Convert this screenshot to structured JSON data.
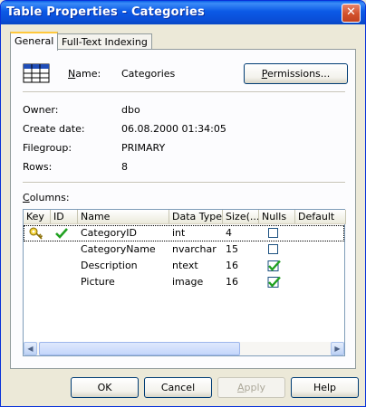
{
  "window": {
    "title": "Table Properties - Categories",
    "close_glyph": "✕"
  },
  "tabs": [
    {
      "label": "General",
      "active": true
    },
    {
      "label": "Full-Text Indexing",
      "active": false
    }
  ],
  "general": {
    "table_icon": "table-grid-icon",
    "name_label": "Name:",
    "name_value": "Categories",
    "permissions_button": "Permissions...",
    "owner_label": "Owner:",
    "owner_value": "dbo",
    "create_date_label": "Create date:",
    "create_date_value": "06.08.2000 01:34:05",
    "filegroup_label": "Filegroup:",
    "filegroup_value": "PRIMARY",
    "rows_label": "Rows:",
    "rows_value": "8",
    "columns_label": "Columns:"
  },
  "columns_grid": {
    "headers": [
      "Key",
      "ID",
      "Name",
      "Data Type",
      "Size(...",
      "Nulls",
      "Default"
    ],
    "rows": [
      {
        "key": true,
        "id": true,
        "name": "CategoryID",
        "type": "int",
        "size": "4",
        "nulls": false,
        "selected": true
      },
      {
        "key": false,
        "id": false,
        "name": "CategoryName",
        "type": "nvarchar",
        "size": "15",
        "nulls": false,
        "selected": false
      },
      {
        "key": false,
        "id": false,
        "name": "Description",
        "type": "ntext",
        "size": "16",
        "nulls": true,
        "selected": false
      },
      {
        "key": false,
        "id": false,
        "name": "Picture",
        "type": "image",
        "size": "16",
        "nulls": true,
        "selected": false
      }
    ]
  },
  "footer": {
    "ok": "OK",
    "cancel": "Cancel",
    "apply": "Apply",
    "help": "Help"
  },
  "colors": {
    "titlebar": "#0a5fe8",
    "checkmark": "#21a121",
    "key_icon": "#d4b000"
  }
}
